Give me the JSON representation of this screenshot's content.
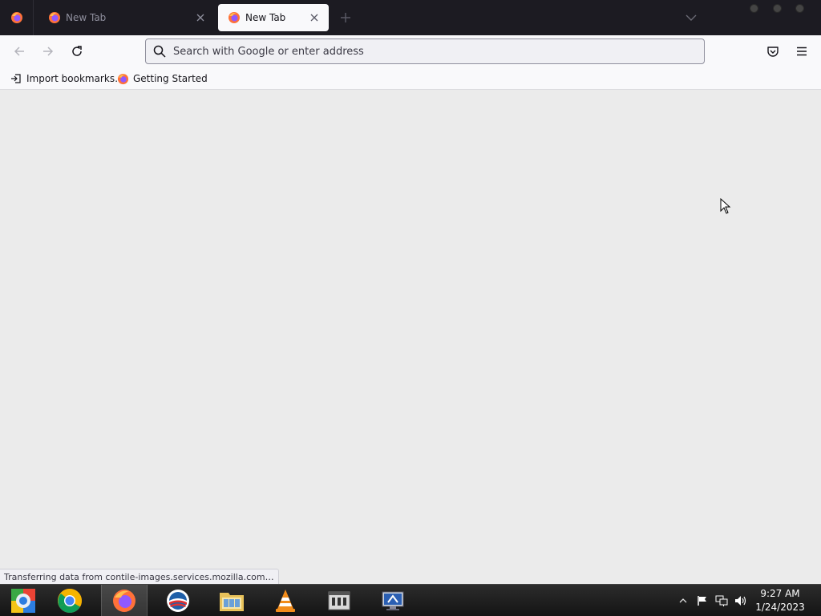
{
  "tabs": [
    {
      "title": "New Tab",
      "active": false
    },
    {
      "title": "New Tab",
      "active": true
    }
  ],
  "urlbar": {
    "placeholder": "Search with Google or enter address",
    "value": ""
  },
  "bookmarks": [
    {
      "label": "Import bookmarks…",
      "icon": "import-icon"
    },
    {
      "label": "Getting Started",
      "icon": "firefox-icon"
    }
  ],
  "status_text": "Transferring data from contile-images.services.mozilla.com…",
  "taskbar": {
    "apps": [
      "start-orb",
      "chrome",
      "firefox",
      "obama-logo",
      "file-explorer",
      "vlc",
      "app-generic",
      "remote-desktop"
    ],
    "active_app": "firefox"
  },
  "clock": {
    "time": "9:27 AM",
    "date": "1/24/2023"
  },
  "colors": {
    "tabstrip": "#1c1b22",
    "toolbar": "#f9f9fb",
    "content": "#ebebeb",
    "taskbar": "#1e1e1e"
  }
}
